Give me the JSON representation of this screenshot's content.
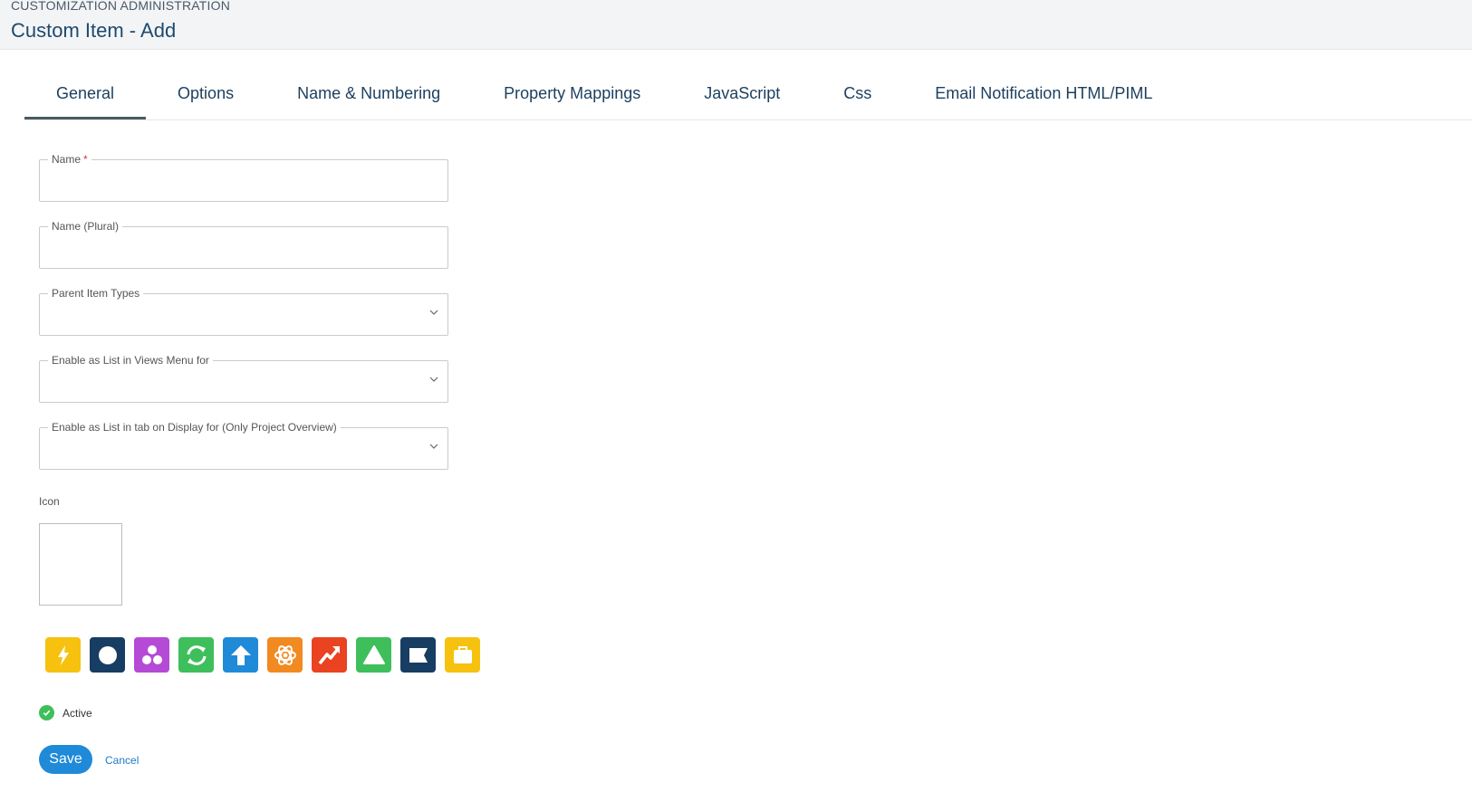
{
  "header": {
    "breadcrumb": "CUSTOMIZATION ADMINISTRATION",
    "title": "Custom Item - Add"
  },
  "tabs": [
    {
      "label": "General",
      "active": true
    },
    {
      "label": "Options",
      "active": false
    },
    {
      "label": "Name & Numbering",
      "active": false
    },
    {
      "label": "Property Mappings",
      "active": false
    },
    {
      "label": "JavaScript",
      "active": false
    },
    {
      "label": "Css",
      "active": false
    },
    {
      "label": "Email Notification HTML/PIML",
      "active": false
    }
  ],
  "form": {
    "name_label": "Name",
    "name_required_marker": "*",
    "name_value": "",
    "plural_label": "Name (Plural)",
    "plural_value": "",
    "parent_types_label": "Parent Item Types",
    "parent_types_value": "",
    "views_menu_label": "Enable as List in Views Menu for",
    "views_menu_value": "",
    "tab_display_label": "Enable as List in tab on Display for (Only Project Overview)",
    "tab_display_value": "",
    "icon_label": "Icon"
  },
  "palette": [
    {
      "name": "lightning-icon",
      "color": "#f6c20f"
    },
    {
      "name": "circle-icon",
      "color": "#173d63"
    },
    {
      "name": "three-dots-icon",
      "color": "#b54ad6"
    },
    {
      "name": "refresh-icon",
      "color": "#3ebf5b"
    },
    {
      "name": "arrow-up-icon",
      "color": "#1f8ad8"
    },
    {
      "name": "atom-icon",
      "color": "#f18a20"
    },
    {
      "name": "trend-up-icon",
      "color": "#e94322"
    },
    {
      "name": "triangle-icon",
      "color": "#3ebf5b"
    },
    {
      "name": "flag-icon",
      "color": "#173d63"
    },
    {
      "name": "briefcase-icon",
      "color": "#f6c20f"
    }
  ],
  "active_label": "Active",
  "actions": {
    "save": "Save",
    "cancel": "Cancel"
  }
}
